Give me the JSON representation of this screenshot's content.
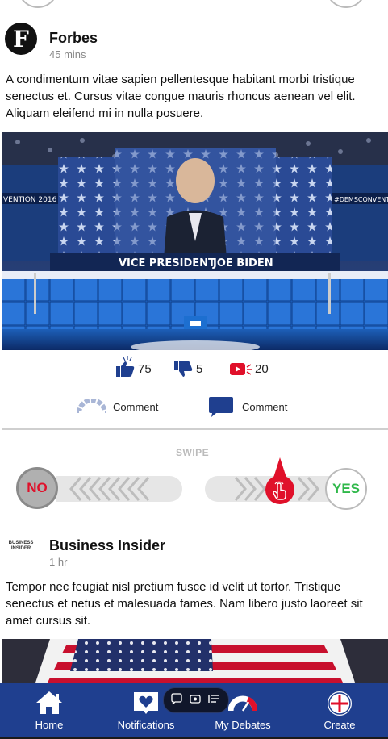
{
  "posts": [
    {
      "source": "Forbes",
      "time": "45 mins",
      "text": "A condimentum vitae sapien pellentesque habitant morbi tristique senectus et. Cursus vitae congue mauris rhoncus aenean vel elit. Aliquam eleifend mi in nulla posuere.",
      "image_sign_left": "VICE PRESIDENT",
      "image_sign_right": "JOE BIDEN",
      "image_side_left": "VENTION 2016",
      "image_side_right": "#DEMSCONVENTION",
      "likes": "75",
      "dislikes": "5",
      "shares": "20",
      "comment_label_1": "Comment",
      "comment_label_2": "Comment"
    },
    {
      "source": "Business Insider",
      "logo_text": "BUSINESS INSIDER",
      "time": "1 hr",
      "text": "Tempor nec feugiat nisl pretium fusce id velit ut tortor. Tristique senectus et netus et malesuada fames. Nam libero justo laoreet sit amet cursus sit."
    }
  ],
  "swipe": {
    "label": "SWIPE",
    "no_label": "NO",
    "yes_label": "YES"
  },
  "nav": {
    "items": [
      {
        "label": "Home",
        "icon": "home-icon"
      },
      {
        "label": "Notifications",
        "icon": "heart-icon"
      },
      {
        "label": "My Debates",
        "icon": "gauge-icon"
      },
      {
        "label": "Create",
        "icon": "plus-circle-icon"
      }
    ]
  },
  "colors": {
    "nav_bg": "#1f3f8f",
    "accent_red": "#e0102a",
    "yes_green": "#2fb84a",
    "no_red": "#e0102a",
    "gray": "#b0b0b0"
  }
}
